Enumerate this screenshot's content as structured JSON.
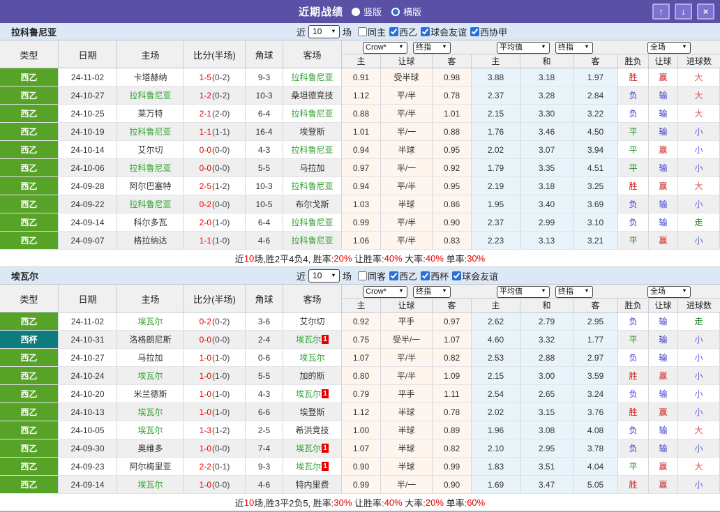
{
  "icons": {
    "caret": "▼",
    "up": "↑",
    "down": "↓",
    "close": "×"
  },
  "colors": {
    "titlebar_bg": "#5a50a5",
    "titlebar_button_bg": "#7d72d0",
    "titlebar_button_border": "#b3aae8",
    "filter_bar_bg": "#dce8f5",
    "header_bg": "#f0f0f0",
    "row_alt_bg": "#efefef",
    "crow_col_bg": "#fdf5ee",
    "avg_col_bg": "#e9f3fa",
    "league_xiyi_green": "#57a327",
    "league_xibei_teal": "#0e7c7c",
    "team_highlight_green": "#2fa12f",
    "score_red": "#e60000",
    "summary_red": "#e60000",
    "checkbox_blue": "#2b6fd6",
    "win_red": "#cc2020",
    "lose_blue": "#3c3ccc",
    "draw_green": "#1f8a1f",
    "big_red": "#e05555",
    "small_blue": "#6565da"
  },
  "titlebar": {
    "title": "近期战绩",
    "layout_options": [
      {
        "label": "竖版",
        "selected": false
      },
      {
        "label": "横版",
        "selected": true
      }
    ]
  },
  "table_header": {
    "main_cols": [
      "类型",
      "日期",
      "主场",
      "比分(半场)",
      "角球",
      "客场"
    ],
    "odds_sub": [
      "主",
      "让球",
      "客"
    ],
    "avg_sub": [
      "主",
      "和",
      "客"
    ],
    "result_sub": [
      "胜负",
      "让球",
      "进球数"
    ],
    "selects": {
      "bookmaker": "Crow*",
      "final_1": "终指",
      "average": "平均值",
      "final_2": "终指",
      "scope": "全场"
    }
  },
  "teams": [
    {
      "name": "拉科鲁尼亚",
      "filter": {
        "prefix": "近",
        "count": "10",
        "suffix": "场",
        "options": [
          {
            "label": "同主",
            "checked": false
          },
          {
            "label": "西乙",
            "checked": true
          },
          {
            "label": "球会友谊",
            "checked": true
          },
          {
            "label": "西协甲",
            "checked": true
          }
        ]
      },
      "rows": [
        {
          "league": "西乙",
          "date": "24-11-02",
          "home": "卡塔赫纳",
          "home_card": "",
          "score_ft": "1-5",
          "score_ht": "0-2",
          "corners": "9-3",
          "away": "拉科鲁尼亚",
          "away_card": "",
          "odds_home": "0.91",
          "odds_handicap": "受半球",
          "odds_away": "0.98",
          "avg_home": "3.88",
          "avg_draw": "3.18",
          "avg_away": "1.97",
          "result_match": "胜",
          "result_handicap": "赢",
          "result_goals": "大"
        },
        {
          "league": "西乙",
          "date": "24-10-27",
          "home": "拉科鲁尼亚",
          "home_card": "",
          "score_ft": "1-2",
          "score_ht": "0-2",
          "corners": "10-3",
          "away": "桑坦德竞技",
          "away_card": "",
          "odds_home": "1.12",
          "odds_handicap": "平/半",
          "odds_away": "0.78",
          "avg_home": "2.37",
          "avg_draw": "3.28",
          "avg_away": "2.84",
          "result_match": "负",
          "result_handicap": "输",
          "result_goals": "大"
        },
        {
          "league": "西乙",
          "date": "24-10-25",
          "home": "莱万特",
          "home_card": "",
          "score_ft": "2-1",
          "score_ht": "2-0",
          "corners": "6-4",
          "away": "拉科鲁尼亚",
          "away_card": "",
          "odds_home": "0.88",
          "odds_handicap": "平/半",
          "odds_away": "1.01",
          "avg_home": "2.15",
          "avg_draw": "3.30",
          "avg_away": "3.22",
          "result_match": "负",
          "result_handicap": "输",
          "result_goals": "大"
        },
        {
          "league": "西乙",
          "date": "24-10-19",
          "home": "拉科鲁尼亚",
          "home_card": "",
          "score_ft": "1-1",
          "score_ht": "1-1",
          "corners": "16-4",
          "away": "埃登斯",
          "away_card": "",
          "odds_home": "1.01",
          "odds_handicap": "半/一",
          "odds_away": "0.88",
          "avg_home": "1.76",
          "avg_draw": "3.46",
          "avg_away": "4.50",
          "result_match": "平",
          "result_handicap": "输",
          "result_goals": "小"
        },
        {
          "league": "西乙",
          "date": "24-10-14",
          "home": "艾尔切",
          "home_card": "",
          "score_ft": "0-0",
          "score_ht": "0-0",
          "corners": "4-3",
          "away": "拉科鲁尼亚",
          "away_card": "",
          "odds_home": "0.94",
          "odds_handicap": "半球",
          "odds_away": "0.95",
          "avg_home": "2.02",
          "avg_draw": "3.07",
          "avg_away": "3.94",
          "result_match": "平",
          "result_handicap": "赢",
          "result_goals": "小"
        },
        {
          "league": "西乙",
          "date": "24-10-06",
          "home": "拉科鲁尼亚",
          "home_card": "",
          "score_ft": "0-0",
          "score_ht": "0-0",
          "corners": "5-5",
          "away": "马拉加",
          "away_card": "",
          "odds_home": "0.97",
          "odds_handicap": "半/一",
          "odds_away": "0.92",
          "avg_home": "1.79",
          "avg_draw": "3.35",
          "avg_away": "4.51",
          "result_match": "平",
          "result_handicap": "输",
          "result_goals": "小"
        },
        {
          "league": "西乙",
          "date": "24-09-28",
          "home": "阿尔巴塞特",
          "home_card": "",
          "score_ft": "2-5",
          "score_ht": "1-2",
          "corners": "10-3",
          "away": "拉科鲁尼亚",
          "away_card": "",
          "odds_home": "0.94",
          "odds_handicap": "平/半",
          "odds_away": "0.95",
          "avg_home": "2.19",
          "avg_draw": "3.18",
          "avg_away": "3.25",
          "result_match": "胜",
          "result_handicap": "赢",
          "result_goals": "大"
        },
        {
          "league": "西乙",
          "date": "24-09-22",
          "home": "拉科鲁尼亚",
          "home_card": "",
          "score_ft": "0-2",
          "score_ht": "0-0",
          "corners": "10-5",
          "away": "布尔戈斯",
          "away_card": "",
          "odds_home": "1.03",
          "odds_handicap": "半球",
          "odds_away": "0.86",
          "avg_home": "1.95",
          "avg_draw": "3.40",
          "avg_away": "3.69",
          "result_match": "负",
          "result_handicap": "输",
          "result_goals": "小"
        },
        {
          "league": "西乙",
          "date": "24-09-14",
          "home": "科尔多瓦",
          "home_card": "",
          "score_ft": "2-0",
          "score_ht": "1-0",
          "corners": "6-4",
          "away": "拉科鲁尼亚",
          "away_card": "",
          "odds_home": "0.99",
          "odds_handicap": "平/半",
          "odds_away": "0.90",
          "avg_home": "2.37",
          "avg_draw": "2.99",
          "avg_away": "3.10",
          "result_match": "负",
          "result_handicap": "输",
          "result_goals": "走"
        },
        {
          "league": "西乙",
          "date": "24-09-07",
          "home": "格拉纳达",
          "home_card": "",
          "score_ft": "1-1",
          "score_ht": "1-0",
          "corners": "4-6",
          "away": "拉科鲁尼亚",
          "away_card": "",
          "odds_home": "1.06",
          "odds_handicap": "平/半",
          "odds_away": "0.83",
          "avg_home": "2.23",
          "avg_draw": "3.13",
          "avg_away": "3.21",
          "result_match": "平",
          "result_handicap": "赢",
          "result_goals": "小"
        }
      ],
      "summary": [
        {
          "text": "近"
        },
        {
          "text": "10",
          "red": true
        },
        {
          "text": "场,胜2平4负4, 胜率:"
        },
        {
          "text": "20%",
          "red": true
        },
        {
          "text": " 让胜率:"
        },
        {
          "text": "40%",
          "red": true
        },
        {
          "text": " 大率:"
        },
        {
          "text": "40%",
          "red": true
        },
        {
          "text": " 单率:"
        },
        {
          "text": "30%",
          "red": true
        }
      ]
    },
    {
      "name": "埃瓦尔",
      "filter": {
        "prefix": "近",
        "count": "10",
        "suffix": "场",
        "options": [
          {
            "label": "同客",
            "checked": false
          },
          {
            "label": "西乙",
            "checked": true
          },
          {
            "label": "西杯",
            "checked": true
          },
          {
            "label": "球会友谊",
            "checked": true
          }
        ]
      },
      "rows": [
        {
          "league": "西乙",
          "date": "24-11-02",
          "home": "埃瓦尔",
          "home_card": "",
          "score_ft": "0-2",
          "score_ht": "0-2",
          "corners": "3-6",
          "away": "艾尔切",
          "away_card": "",
          "odds_home": "0.92",
          "odds_handicap": "平手",
          "odds_away": "0.97",
          "avg_home": "2.62",
          "avg_draw": "2.79",
          "avg_away": "2.95",
          "result_match": "负",
          "result_handicap": "输",
          "result_goals": "走"
        },
        {
          "league": "西杯",
          "date": "24-10-31",
          "home": "洛格朗尼斯",
          "home_card": "",
          "score_ft": "0-0",
          "score_ht": "0-0",
          "corners": "2-4",
          "away": "埃瓦尔",
          "away_card": "1",
          "odds_home": "0.75",
          "odds_handicap": "受半/一",
          "odds_away": "1.07",
          "avg_home": "4.60",
          "avg_draw": "3.32",
          "avg_away": "1.77",
          "result_match": "平",
          "result_handicap": "输",
          "result_goals": "小"
        },
        {
          "league": "西乙",
          "date": "24-10-27",
          "home": "马拉加",
          "home_card": "",
          "score_ft": "1-0",
          "score_ht": "1-0",
          "corners": "0-6",
          "away": "埃瓦尔",
          "away_card": "",
          "odds_home": "1.07",
          "odds_handicap": "平/半",
          "odds_away": "0.82",
          "avg_home": "2.53",
          "avg_draw": "2.88",
          "avg_away": "2.97",
          "result_match": "负",
          "result_handicap": "输",
          "result_goals": "小"
        },
        {
          "league": "西乙",
          "date": "24-10-24",
          "home": "埃瓦尔",
          "home_card": "",
          "score_ft": "1-0",
          "score_ht": "1-0",
          "corners": "5-5",
          "away": "加的斯",
          "away_card": "",
          "odds_home": "0.80",
          "odds_handicap": "平/半",
          "odds_away": "1.09",
          "avg_home": "2.15",
          "avg_draw": "3.00",
          "avg_away": "3.59",
          "result_match": "胜",
          "result_handicap": "赢",
          "result_goals": "小"
        },
        {
          "league": "西乙",
          "date": "24-10-20",
          "home": "米兰德斯",
          "home_card": "",
          "score_ft": "1-0",
          "score_ht": "1-0",
          "corners": "4-3",
          "away": "埃瓦尔",
          "away_card": "1",
          "odds_home": "0.79",
          "odds_handicap": "平手",
          "odds_away": "1.11",
          "avg_home": "2.54",
          "avg_draw": "2.65",
          "avg_away": "3.24",
          "result_match": "负",
          "result_handicap": "输",
          "result_goals": "小"
        },
        {
          "league": "西乙",
          "date": "24-10-13",
          "home": "埃瓦尔",
          "home_card": "",
          "score_ft": "1-0",
          "score_ht": "1-0",
          "corners": "6-6",
          "away": "埃登斯",
          "away_card": "",
          "odds_home": "1.12",
          "odds_handicap": "半球",
          "odds_away": "0.78",
          "avg_home": "2.02",
          "avg_draw": "3.15",
          "avg_away": "3.76",
          "result_match": "胜",
          "result_handicap": "赢",
          "result_goals": "小"
        },
        {
          "league": "西乙",
          "date": "24-10-05",
          "home": "埃瓦尔",
          "home_card": "",
          "score_ft": "1-3",
          "score_ht": "1-2",
          "corners": "2-5",
          "away": "希洪竞技",
          "away_card": "",
          "odds_home": "1.00",
          "odds_handicap": "半球",
          "odds_away": "0.89",
          "avg_home": "1.96",
          "avg_draw": "3.08",
          "avg_away": "4.08",
          "result_match": "负",
          "result_handicap": "输",
          "result_goals": "大"
        },
        {
          "league": "西乙",
          "date": "24-09-30",
          "home": "奥维多",
          "home_card": "",
          "score_ft": "1-0",
          "score_ht": "0-0",
          "corners": "7-4",
          "away": "埃瓦尔",
          "away_card": "1",
          "odds_home": "1.07",
          "odds_handicap": "半球",
          "odds_away": "0.82",
          "avg_home": "2.10",
          "avg_draw": "2.95",
          "avg_away": "3.78",
          "result_match": "负",
          "result_handicap": "输",
          "result_goals": "小"
        },
        {
          "league": "西乙",
          "date": "24-09-23",
          "home": "阿尔梅里亚",
          "home_card": "",
          "score_ft": "2-2",
          "score_ht": "0-1",
          "corners": "9-3",
          "away": "埃瓦尔",
          "away_card": "1",
          "odds_home": "0.90",
          "odds_handicap": "半球",
          "odds_away": "0.99",
          "avg_home": "1.83",
          "avg_draw": "3.51",
          "avg_away": "4.04",
          "result_match": "平",
          "result_handicap": "赢",
          "result_goals": "大"
        },
        {
          "league": "西乙",
          "date": "24-09-14",
          "home": "埃瓦尔",
          "home_card": "",
          "score_ft": "1-0",
          "score_ht": "0-0",
          "corners": "4-6",
          "away": "特内里费",
          "away_card": "",
          "odds_home": "0.99",
          "odds_handicap": "半/一",
          "odds_away": "0.90",
          "avg_home": "1.69",
          "avg_draw": "3.47",
          "avg_away": "5.05",
          "result_match": "胜",
          "result_handicap": "赢",
          "result_goals": "小"
        }
      ],
      "summary": [
        {
          "text": "近"
        },
        {
          "text": "10",
          "red": true
        },
        {
          "text": "场,胜3平2负5, 胜率:"
        },
        {
          "text": "30%",
          "red": true
        },
        {
          "text": " 让胜率:"
        },
        {
          "text": "40%",
          "red": true
        },
        {
          "text": " 大率:"
        },
        {
          "text": "20%",
          "red": true
        },
        {
          "text": " 单率:"
        },
        {
          "text": "60%",
          "red": true
        }
      ]
    }
  ]
}
